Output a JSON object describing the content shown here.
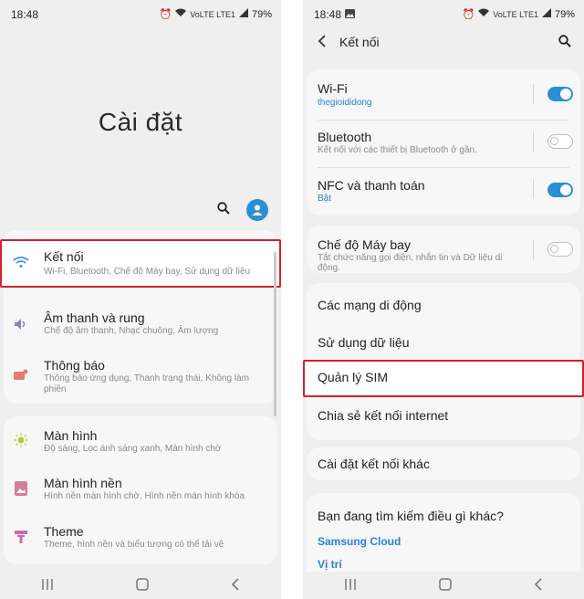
{
  "left": {
    "status": {
      "time": "18:48",
      "battery": "79%",
      "network": "VoLTE LTE1"
    },
    "page_title": "Cài đặt",
    "items": [
      {
        "title": "Kết nối",
        "sub": "Wi-Fi, Bluetooth, Chế độ Máy bay, Sử dụng dữ liệu"
      },
      {
        "title": "Âm thanh và rung",
        "sub": "Chế độ âm thanh, Nhạc chuông, Âm lượng"
      },
      {
        "title": "Thông báo",
        "sub": "Thông báo ứng dụng, Thanh trạng thái, Không làm phiền"
      },
      {
        "title": "Màn hình",
        "sub": "Độ sáng, Lọc ánh sáng xanh, Màn hình chờ"
      },
      {
        "title": "Màn hình nền",
        "sub": "Hình nền màn hình chờ, Hình nền màn hình khóa"
      },
      {
        "title": "Theme",
        "sub": "Theme, hình nền và biểu tượng có thể tải về"
      }
    ]
  },
  "right": {
    "status": {
      "time": "18:48",
      "battery": "79%",
      "network": "VoLTE LTE1"
    },
    "header_title": "Kết nối",
    "items": [
      {
        "title": "Wi-Fi",
        "sub": "thegioididong",
        "toggle": "on"
      },
      {
        "title": "Bluetooth",
        "sub": "Kết nối với các thiết bị Bluetooth ở gần.",
        "toggle": "off"
      },
      {
        "title": "NFC và thanh toán",
        "sub": "Bật",
        "toggle": "on"
      },
      {
        "title": "Chế độ Máy bay",
        "sub": "Tắt chức năng gọi điện, nhắn tin và Dữ liệu di động.",
        "toggle": "off"
      },
      {
        "title": "Các mạng di động"
      },
      {
        "title": "Sử dụng dữ liệu"
      },
      {
        "title": "Quản lý SIM"
      },
      {
        "title": "Chia sẻ kết nối internet"
      },
      {
        "title": "Cài đặt kết nối khác"
      }
    ],
    "suggest": {
      "heading": "Bạn đang tìm kiếm điều gì khác?",
      "links": [
        "Samsung Cloud",
        "Vị trí"
      ]
    }
  },
  "colors": {
    "accent": "#2b8fd6",
    "highlight": "#d6202a",
    "background": "#efeff0"
  }
}
